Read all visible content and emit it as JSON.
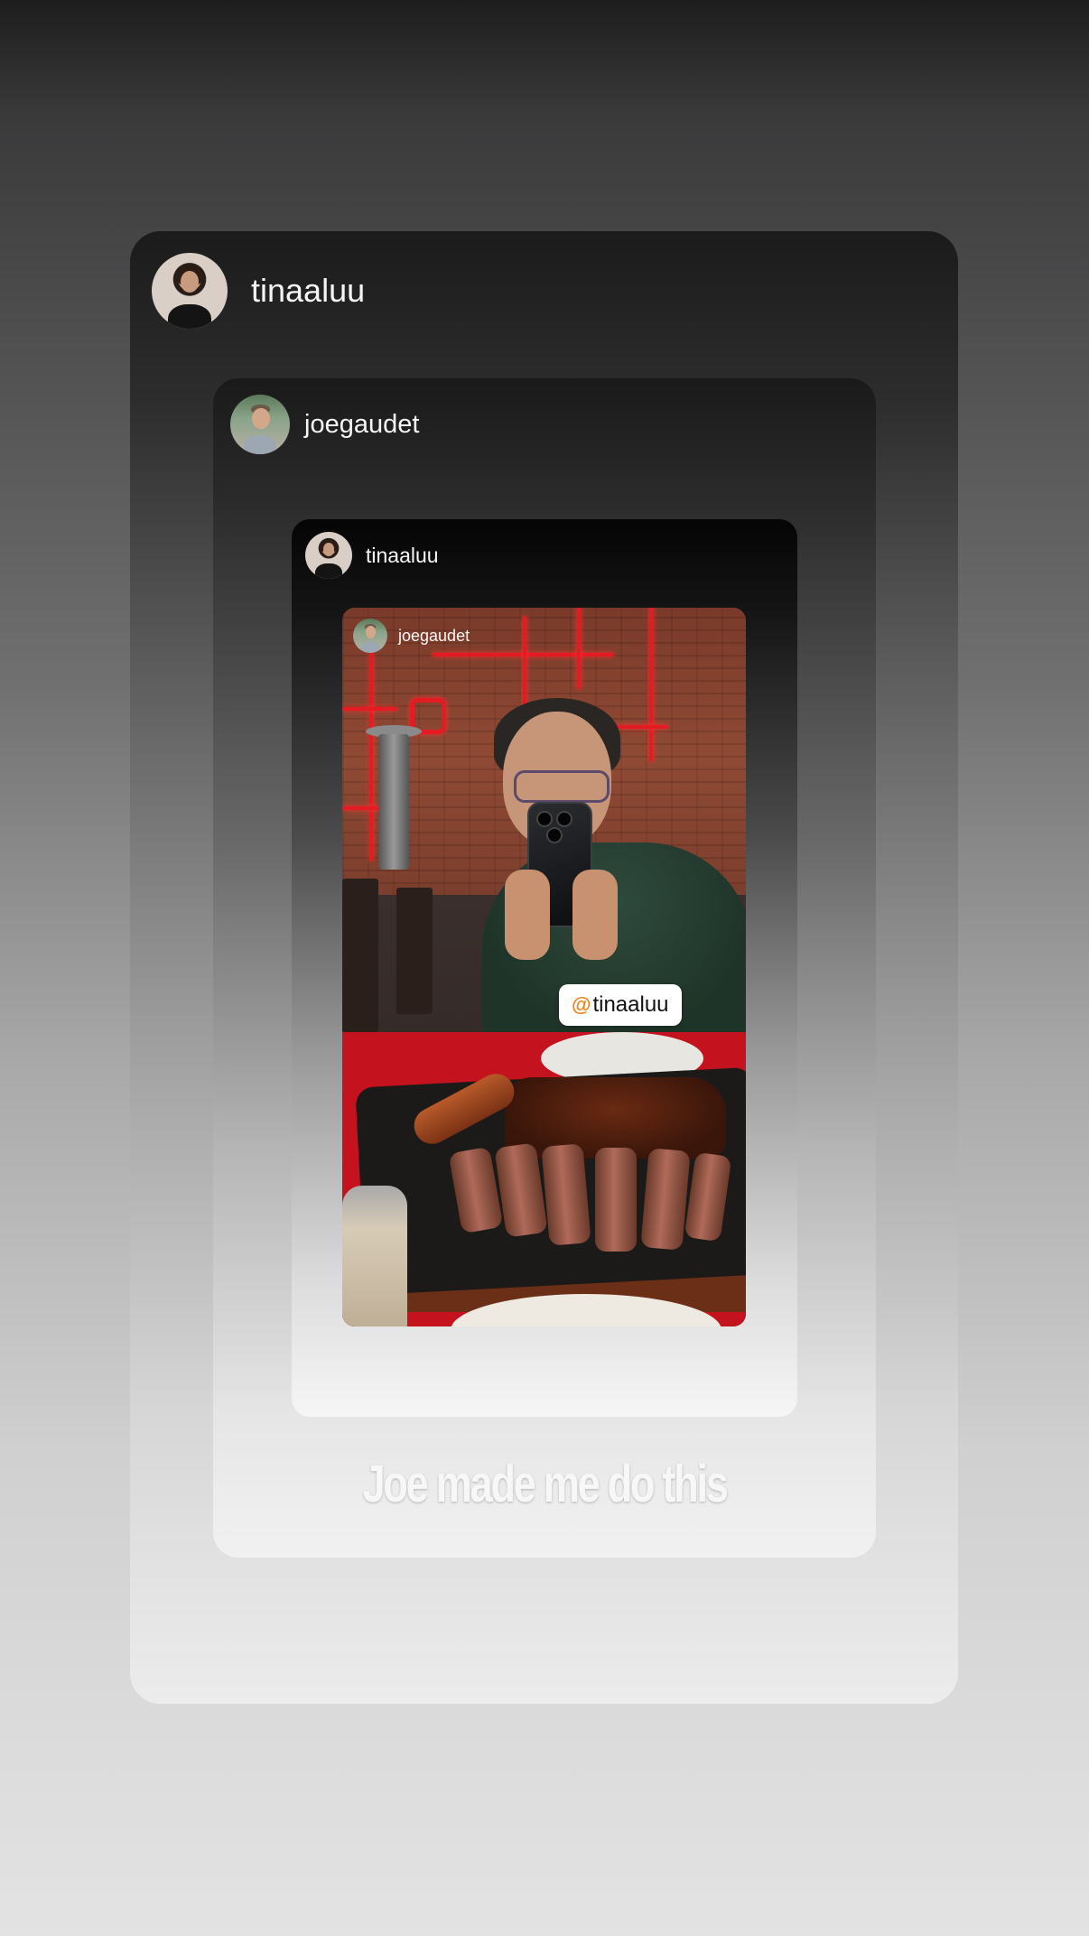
{
  "outer_story": {
    "username": "tinaaluu"
  },
  "middle_story": {
    "username": "joegaudet",
    "caption": "Joe made me do this"
  },
  "inner_story": {
    "username": "tinaaluu"
  },
  "photo_story": {
    "username": "joegaudet",
    "mention": "tinaaluu"
  },
  "icons": {
    "mention": "at-sign-icon"
  },
  "colors": {
    "mention_icon": "#e8871a",
    "neon_sign": "#e51b24"
  }
}
